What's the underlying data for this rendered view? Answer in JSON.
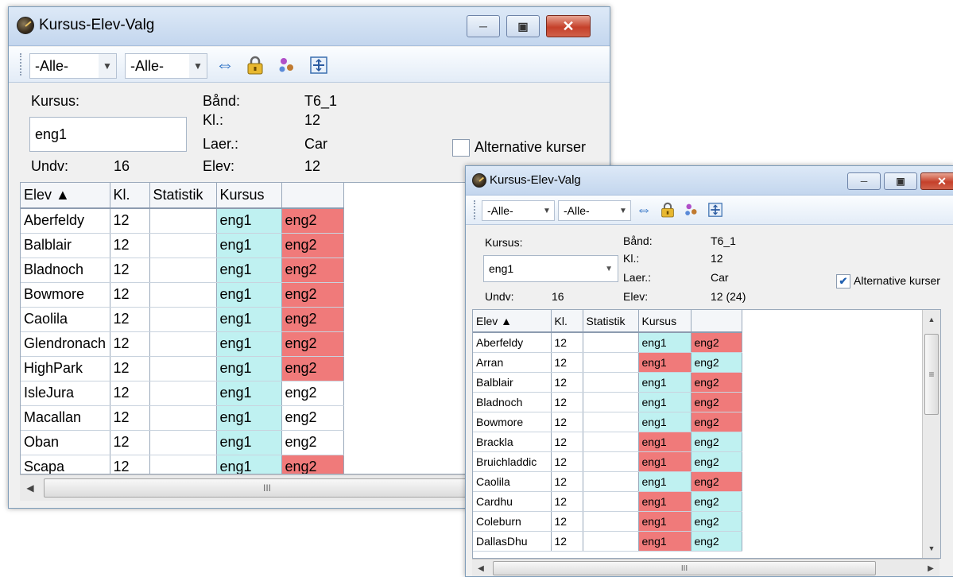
{
  "back_window": {
    "title": "Kursus-Elev-Valg",
    "toolbar": {
      "filter1": "-Alle-",
      "filter2": "-Alle-",
      "icons": [
        "swap-arrows-icon",
        "lock-icon",
        "users-icon",
        "fit-grid-icon"
      ]
    },
    "info": {
      "kursus_label": "Kursus:",
      "kursus_value": "eng1",
      "undv_label": "Undv:",
      "undv_value": "16",
      "band_label": "Bånd:",
      "band_value": "T6_1",
      "kl_label": "Kl.:",
      "kl_value": "12",
      "laer_label": "Laer.:",
      "laer_value": "Car",
      "elev_label": "Elev:",
      "elev_value": "12"
    },
    "alt_kurser_label": "Alternative kurser",
    "alt_kurser_checked": false,
    "columns": [
      "Elev ▲",
      "Kl.",
      "Statistik",
      "Kursus",
      ""
    ],
    "rows": [
      {
        "elev": "Aberfeldy",
        "kl": "12",
        "stat": "",
        "c1": "eng1",
        "c1s": "cyan",
        "c2": "eng2",
        "c2s": "red"
      },
      {
        "elev": "Balblair",
        "kl": "12",
        "stat": "",
        "c1": "eng1",
        "c1s": "cyan",
        "c2": "eng2",
        "c2s": "red"
      },
      {
        "elev": "Bladnoch",
        "kl": "12",
        "stat": "",
        "c1": "eng1",
        "c1s": "cyan",
        "c2": "eng2",
        "c2s": "red"
      },
      {
        "elev": "Bowmore",
        "kl": "12",
        "stat": "",
        "c1": "eng1",
        "c1s": "cyan",
        "c2": "eng2",
        "c2s": "red"
      },
      {
        "elev": "Caolila",
        "kl": "12",
        "stat": "",
        "c1": "eng1",
        "c1s": "cyan",
        "c2": "eng2",
        "c2s": "red"
      },
      {
        "elev": "Glendronach",
        "kl": "12",
        "stat": "",
        "c1": "eng1",
        "c1s": "cyan",
        "c2": "eng2",
        "c2s": "red"
      },
      {
        "elev": "HighPark",
        "kl": "12",
        "stat": "",
        "c1": "eng1",
        "c1s": "cyan",
        "c2": "eng2",
        "c2s": "red"
      },
      {
        "elev": "IsleJura",
        "kl": "12",
        "stat": "",
        "c1": "eng1",
        "c1s": "cyan",
        "c2": "eng2",
        "c2s": "nc"
      },
      {
        "elev": "Macallan",
        "kl": "12",
        "stat": "",
        "c1": "eng1",
        "c1s": "cyan",
        "c2": "eng2",
        "c2s": "nc"
      },
      {
        "elev": "Oban",
        "kl": "12",
        "stat": "",
        "c1": "eng1",
        "c1s": "cyan",
        "c2": "eng2",
        "c2s": "nc"
      },
      {
        "elev": "Scapa",
        "kl": "12",
        "stat": "",
        "c1": "eng1",
        "c1s": "cyan",
        "c2": "eng2",
        "c2s": "red"
      }
    ],
    "scroll_grip": "III"
  },
  "front_window": {
    "title": "Kursus-Elev-Valg",
    "toolbar": {
      "filter1": "-Alle-",
      "filter2": "-Alle-",
      "icons": [
        "swap-arrows-icon",
        "lock-icon",
        "users-icon",
        "fit-grid-icon"
      ]
    },
    "info": {
      "kursus_label": "Kursus:",
      "kursus_value": "eng1",
      "undv_label": "Undv:",
      "undv_value": "16",
      "band_label": "Bånd:",
      "band_value": "T6_1",
      "kl_label": "Kl.:",
      "kl_value": "12",
      "laer_label": "Laer.:",
      "laer_value": "Car",
      "elev_label": "Elev:",
      "elev_value": "12 (24)"
    },
    "alt_kurser_label": "Alternative kurser",
    "alt_kurser_checked": true,
    "columns": [
      "Elev ▲",
      "Kl.",
      "Statistik",
      "Kursus",
      ""
    ],
    "rows": [
      {
        "elev": "Aberfeldy",
        "kl": "12",
        "stat": "",
        "c1": "eng1",
        "c1s": "cyan",
        "c2": "eng2",
        "c2s": "red"
      },
      {
        "elev": "Arran",
        "kl": "12",
        "stat": "",
        "c1": "eng1",
        "c1s": "red",
        "c2": "eng2",
        "c2s": "cyan"
      },
      {
        "elev": "Balblair",
        "kl": "12",
        "stat": "",
        "c1": "eng1",
        "c1s": "cyan",
        "c2": "eng2",
        "c2s": "red"
      },
      {
        "elev": "Bladnoch",
        "kl": "12",
        "stat": "",
        "c1": "eng1",
        "c1s": "cyan",
        "c2": "eng2",
        "c2s": "red"
      },
      {
        "elev": "Bowmore",
        "kl": "12",
        "stat": "",
        "c1": "eng1",
        "c1s": "cyan",
        "c2": "eng2",
        "c2s": "red"
      },
      {
        "elev": "Brackla",
        "kl": "12",
        "stat": "",
        "c1": "eng1",
        "c1s": "red",
        "c2": "eng2",
        "c2s": "cyan"
      },
      {
        "elev": "Bruichladdic",
        "kl": "12",
        "stat": "",
        "c1": "eng1",
        "c1s": "red",
        "c2": "eng2",
        "c2s": "cyan"
      },
      {
        "elev": "Caolila",
        "kl": "12",
        "stat": "",
        "c1": "eng1",
        "c1s": "cyan",
        "c2": "eng2",
        "c2s": "red"
      },
      {
        "elev": "Cardhu",
        "kl": "12",
        "stat": "",
        "c1": "eng1",
        "c1s": "red",
        "c2": "eng2",
        "c2s": "cyan"
      },
      {
        "elev": "Coleburn",
        "kl": "12",
        "stat": "",
        "c1": "eng1",
        "c1s": "red",
        "c2": "eng2",
        "c2s": "cyan"
      },
      {
        "elev": "DallasDhu",
        "kl": "12",
        "stat": "",
        "c1": "eng1",
        "c1s": "red",
        "c2": "eng2",
        "c2s": "cyan"
      }
    ],
    "scroll_grip": "III",
    "vscroll_grip": "≡"
  },
  "colors": {
    "cyan": "#bff1f1",
    "red": "#f07a7a",
    "close_button": "#c5402a",
    "titlebar": "#c3d6ee"
  }
}
